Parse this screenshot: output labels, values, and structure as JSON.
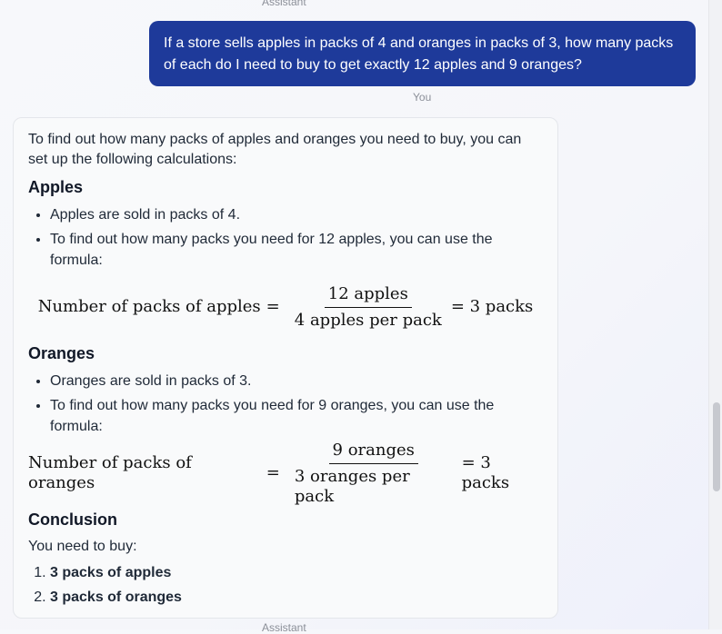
{
  "top_role_label": "Assistant",
  "user_message": {
    "text": "If a store sells apples in packs of 4 and oranges in packs of 3, how many packs of each do I need to buy to get exactly 12 apples and 9 oranges?",
    "role_label": "You"
  },
  "assistant_message": {
    "intro": "To find out how many packs of apples and oranges you need to buy, you can set up the following calculations:",
    "apples": {
      "heading": "Apples",
      "bullets": [
        "Apples are sold in packs of 4.",
        "To find out how many packs you need for 12 apples, you can use the formula:"
      ],
      "formula": {
        "lhs": "Number of packs of apples",
        "eq": "=",
        "numerator": "12 apples",
        "denominator": "4 apples per pack",
        "result": "= 3 packs"
      }
    },
    "oranges": {
      "heading": "Oranges",
      "bullets": [
        "Oranges are sold in packs of 3.",
        "To find out how many packs you need for 9 oranges, you can use the formula:"
      ],
      "formula": {
        "lhs": "Number of packs of oranges",
        "eq": "=",
        "numerator": "9 oranges",
        "denominator": "3 oranges per pack",
        "result": "= 3 packs"
      }
    },
    "conclusion": {
      "heading": "Conclusion",
      "text": "You need to buy:",
      "items": [
        "3 packs of apples",
        "3 packs of oranges"
      ]
    }
  },
  "bottom_role_label": "Assistant"
}
